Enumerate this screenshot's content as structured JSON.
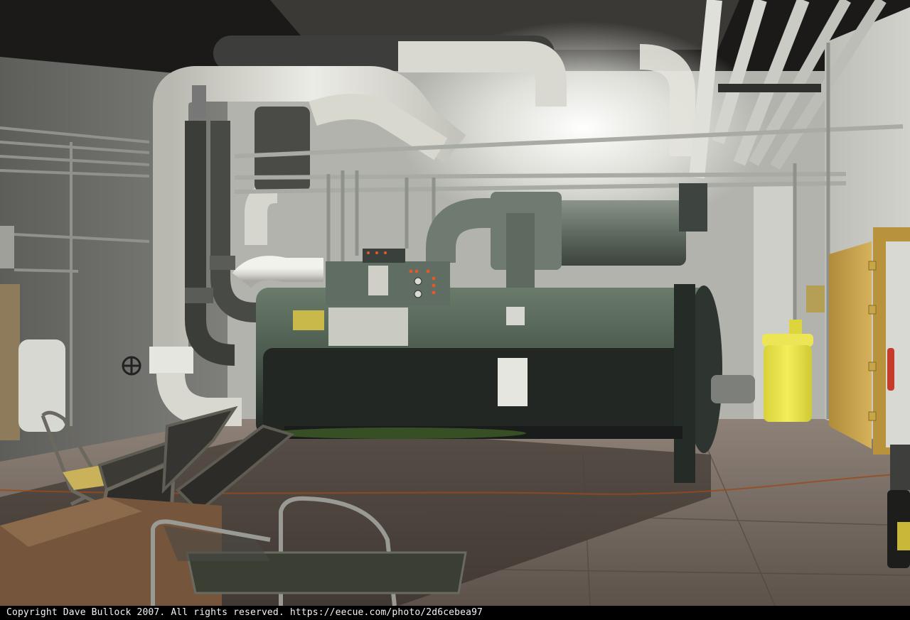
{
  "photo": {
    "subject": "chiller-room",
    "copyright_caption": "Copyright Dave Bullock 2007. All rights reserved. https://eecue.com/photo/2d6cebea97"
  },
  "palette": {
    "ceiling": "#1b1a18",
    "wall_left": "#6f706c",
    "wall_back": "#b9b9b4",
    "wall_right": "#c9c9c4",
    "floor": "#6e625a",
    "pipe_white": "#dcdcd4",
    "pipe_grey": "#9a9d98",
    "chiller_green": "#4f5f52",
    "chiller_dark": "#2a302b",
    "door": "#c9a24a",
    "bin_yellow": "#e9e34a"
  }
}
